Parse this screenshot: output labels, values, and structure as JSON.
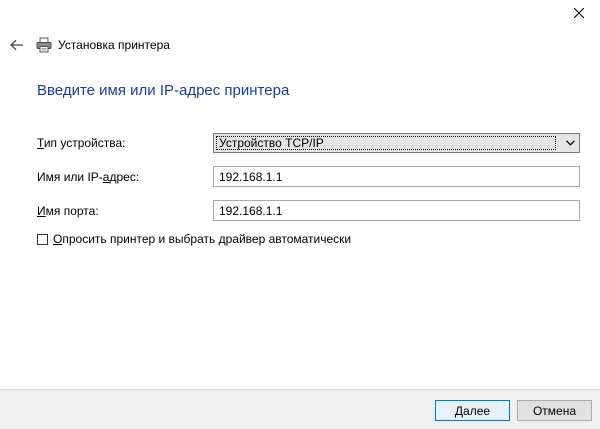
{
  "window": {
    "title": "Установка принтера",
    "icons": {
      "close": "close-icon",
      "back": "back-arrow-icon",
      "printer": "printer-icon"
    }
  },
  "page": {
    "heading": "Введите имя или IP-адрес принтера"
  },
  "form": {
    "device_type": {
      "label_prefix": "",
      "label_accel": "Т",
      "label_rest": "ип устройства:",
      "selected": "Устройство TCP/IP"
    },
    "hostname": {
      "label_prefix": "Имя или IP-",
      "label_accel": "а",
      "label_rest": "дрес:",
      "value": "192.168.1.1"
    },
    "port_name": {
      "label_prefix": "",
      "label_accel": "И",
      "label_rest": "мя порта:",
      "value": "192.168.1.1"
    },
    "auto_driver": {
      "label_prefix": "",
      "label_accel": "О",
      "label_rest": "просить принтер и выбрать драйвер автоматически",
      "checked": false
    }
  },
  "footer": {
    "next_prefix": "",
    "next_accel": "Д",
    "next_rest": "алее",
    "cancel_label": "Отмена"
  },
  "colors": {
    "heading": "#1a3c9e",
    "default_button_border": "#0078d7"
  }
}
